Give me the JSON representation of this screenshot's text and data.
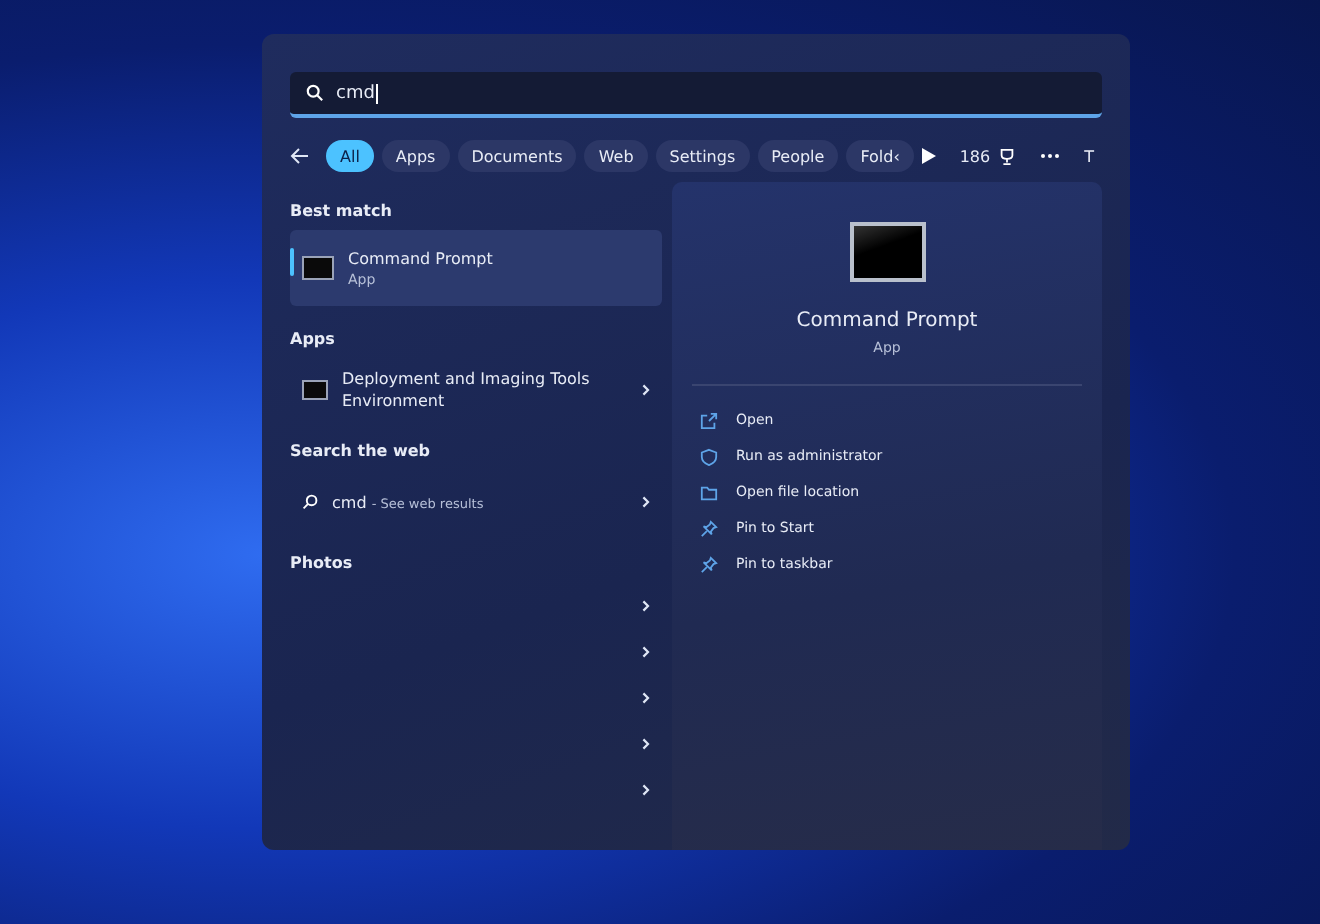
{
  "search": {
    "value": "cmd"
  },
  "filters": [
    {
      "label": "All",
      "selected": true
    },
    {
      "label": "Apps",
      "selected": false
    },
    {
      "label": "Documents",
      "selected": false
    },
    {
      "label": "Web",
      "selected": false
    },
    {
      "label": "Settings",
      "selected": false
    },
    {
      "label": "People",
      "selected": false
    },
    {
      "label": "Fold‹",
      "selected": false
    }
  ],
  "rewards": "186",
  "account_initial": "T",
  "best_match": {
    "heading": "Best match",
    "title": "Command Prompt",
    "subtitle": "App",
    "selected": true
  },
  "apps": {
    "heading": "Apps",
    "items": [
      {
        "title": "Deployment and Imaging Tools Environment"
      }
    ]
  },
  "web": {
    "heading": "Search the web",
    "query": "cmd",
    "suffix": "- See web results"
  },
  "photos": {
    "heading": "Photos",
    "rows": [
      {
        "chevron": true
      },
      {
        "chevron": true
      },
      {
        "chevron": true
      },
      {
        "chevron": true
      },
      {
        "chevron": true
      }
    ]
  },
  "detail": {
    "title": "Command Prompt",
    "subtitle": "App",
    "actions": [
      {
        "kind": "open",
        "label": "Open"
      },
      {
        "kind": "admin",
        "label": "Run as administrator"
      },
      {
        "kind": "folder",
        "label": "Open file location"
      },
      {
        "kind": "pin",
        "label": "Pin to Start"
      },
      {
        "kind": "pin",
        "label": "Pin to taskbar"
      }
    ]
  }
}
